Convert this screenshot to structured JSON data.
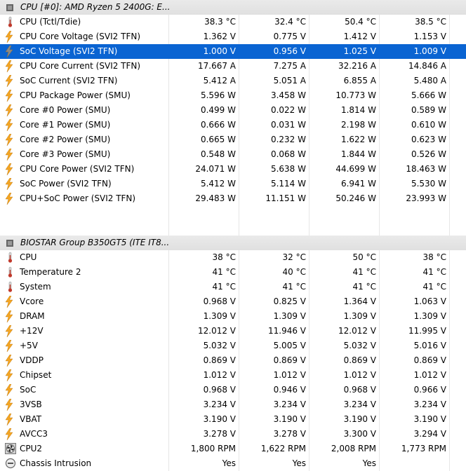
{
  "groups": [
    {
      "title": "CPU [#0]: AMD Ryzen 5 2400G: E...",
      "rows": [
        {
          "icon": "thermometer-icon",
          "label": "CPU (Tctl/Tdie)",
          "values": [
            "38.3 °C",
            "32.4 °C",
            "50.4 °C",
            "38.5 °C"
          ]
        },
        {
          "icon": "voltage-bolt-icon",
          "label": "CPU Core Voltage (SVI2 TFN)",
          "values": [
            "1.362 V",
            "0.775 V",
            "1.412 V",
            "1.153 V"
          ]
        },
        {
          "icon": "voltage-bolt-icon",
          "label": "SoC Voltage (SVI2 TFN)",
          "values": [
            "1.000 V",
            "0.956 V",
            "1.025 V",
            "1.009 V"
          ],
          "selected": true
        },
        {
          "icon": "current-bolt-icon",
          "label": "CPU Core Current (SVI2 TFN)",
          "values": [
            "17.667 A",
            "7.275 A",
            "32.216 A",
            "14.846 A"
          ]
        },
        {
          "icon": "current-bolt-icon",
          "label": "SoC Current (SVI2 TFN)",
          "values": [
            "5.412 A",
            "5.051 A",
            "6.855 A",
            "5.480 A"
          ]
        },
        {
          "icon": "power-bolt-icon",
          "label": "CPU Package Power (SMU)",
          "values": [
            "5.596 W",
            "3.458 W",
            "10.773 W",
            "5.666 W"
          ]
        },
        {
          "icon": "power-bolt-icon",
          "label": "Core #0 Power (SMU)",
          "values": [
            "0.499 W",
            "0.022 W",
            "1.814 W",
            "0.589 W"
          ]
        },
        {
          "icon": "power-bolt-icon",
          "label": "Core #1 Power (SMU)",
          "values": [
            "0.666 W",
            "0.031 W",
            "2.198 W",
            "0.610 W"
          ]
        },
        {
          "icon": "power-bolt-icon",
          "label": "Core #2 Power (SMU)",
          "values": [
            "0.665 W",
            "0.232 W",
            "1.622 W",
            "0.623 W"
          ]
        },
        {
          "icon": "power-bolt-icon",
          "label": "Core #3 Power (SMU)",
          "values": [
            "0.548 W",
            "0.068 W",
            "1.844 W",
            "0.526 W"
          ]
        },
        {
          "icon": "power-bolt-icon",
          "label": "CPU Core Power (SVI2 TFN)",
          "values": [
            "24.071 W",
            "5.638 W",
            "44.699 W",
            "18.463 W"
          ]
        },
        {
          "icon": "power-bolt-icon",
          "label": "SoC Power (SVI2 TFN)",
          "values": [
            "5.412 W",
            "5.114 W",
            "6.941 W",
            "5.530 W"
          ]
        },
        {
          "icon": "power-bolt-icon",
          "label": "CPU+SoC Power (SVI2 TFN)",
          "values": [
            "29.483 W",
            "11.151 W",
            "50.246 W",
            "23.993 W"
          ]
        }
      ]
    },
    {
      "title": "BIOSTAR Group B350GT5 (ITE IT8...",
      "rows": [
        {
          "icon": "thermometer-icon",
          "label": "CPU",
          "values": [
            "38 °C",
            "32 °C",
            "50 °C",
            "38 °C"
          ]
        },
        {
          "icon": "thermometer-icon",
          "label": "Temperature 2",
          "values": [
            "41 °C",
            "40 °C",
            "41 °C",
            "41 °C"
          ]
        },
        {
          "icon": "thermometer-icon",
          "label": "System",
          "values": [
            "41 °C",
            "41 °C",
            "41 °C",
            "41 °C"
          ]
        },
        {
          "icon": "voltage-bolt-icon",
          "label": "Vcore",
          "values": [
            "0.968 V",
            "0.825 V",
            "1.364 V",
            "1.063 V"
          ]
        },
        {
          "icon": "voltage-bolt-icon",
          "label": "DRAM",
          "values": [
            "1.309 V",
            "1.309 V",
            "1.309 V",
            "1.309 V"
          ]
        },
        {
          "icon": "voltage-bolt-icon",
          "label": "+12V",
          "values": [
            "12.012 V",
            "11.946 V",
            "12.012 V",
            "11.995 V"
          ]
        },
        {
          "icon": "voltage-bolt-icon",
          "label": "+5V",
          "values": [
            "5.032 V",
            "5.005 V",
            "5.032 V",
            "5.016 V"
          ]
        },
        {
          "icon": "voltage-bolt-icon",
          "label": "VDDP",
          "values": [
            "0.869 V",
            "0.869 V",
            "0.869 V",
            "0.869 V"
          ]
        },
        {
          "icon": "voltage-bolt-icon",
          "label": "Chipset",
          "values": [
            "1.012 V",
            "1.012 V",
            "1.012 V",
            "1.012 V"
          ]
        },
        {
          "icon": "voltage-bolt-icon",
          "label": "SoC",
          "values": [
            "0.968 V",
            "0.946 V",
            "0.968 V",
            "0.966 V"
          ]
        },
        {
          "icon": "voltage-bolt-icon",
          "label": "3VSB",
          "values": [
            "3.234 V",
            "3.234 V",
            "3.234 V",
            "3.234 V"
          ]
        },
        {
          "icon": "voltage-bolt-icon",
          "label": "VBAT",
          "values": [
            "3.190 V",
            "3.190 V",
            "3.190 V",
            "3.190 V"
          ]
        },
        {
          "icon": "voltage-bolt-icon",
          "label": "AVCC3",
          "values": [
            "3.278 V",
            "3.278 V",
            "3.300 V",
            "3.294 V"
          ]
        },
        {
          "icon": "fan-icon",
          "label": "CPU2",
          "values": [
            "1,800 RPM",
            "1,622 RPM",
            "2,008 RPM",
            "1,773 RPM"
          ]
        },
        {
          "icon": "intrusion-icon",
          "label": "Chassis Intrusion",
          "values": [
            "Yes",
            "Yes",
            "Yes",
            ""
          ]
        }
      ]
    }
  ],
  "colors": {
    "selection": "#0a64d2",
    "gridline": "#e6e6e6",
    "header_bg": "#e3e3e3",
    "thermo_red": "#c0392b",
    "bolt_orange": "#f5a623",
    "bolt_gray": "#8a8a8a"
  }
}
